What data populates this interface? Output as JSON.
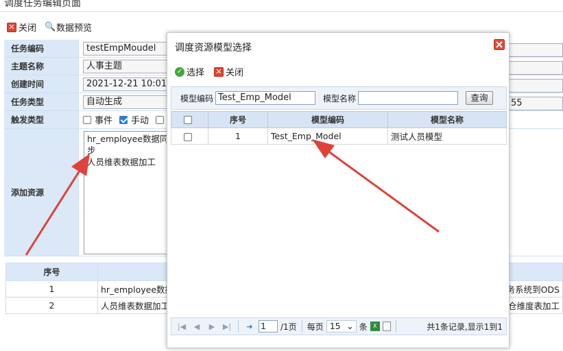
{
  "page_title": "调度任务编辑页面",
  "toolbar": {
    "close_label": "关闭",
    "preview_label": "数据预览"
  },
  "form": {
    "task_code": {
      "label": "任务编码",
      "value": "testEmpMoudel"
    },
    "subject": {
      "label": "主题名称",
      "value": "人事主题"
    },
    "created": {
      "label": "创建时间",
      "value": "2021-12-21 10:01"
    },
    "task_type": {
      "label": "任务类型",
      "value": "自动生成",
      "right_value": "55"
    },
    "trigger": {
      "label": "触发类型",
      "opt_event": "事件",
      "opt_manual": "手动",
      "event_checked": false,
      "manual_checked": true
    },
    "add_resource": {
      "label": "添加资源",
      "line1": "hr_employee数据同步",
      "line2": "人员维表数据加工"
    }
  },
  "bottom_table": {
    "header_seq": "序号",
    "rows": [
      {
        "seq": "1",
        "name": "hr_employee数据",
        "right": "务系统到ODS"
      },
      {
        "seq": "2",
        "name": "人员维表数据加工",
        "right": "仓维度表加工"
      }
    ]
  },
  "modal": {
    "title": "调度资源模型选择",
    "select_label": "选择",
    "close_label": "关闭",
    "search": {
      "code_label": "模型编码",
      "code_value": "Test_Emp_Model",
      "name_label": "模型名称",
      "name_value": "",
      "query_label": "查询"
    },
    "columns": {
      "seq": "序号",
      "code": "模型编码",
      "name": "模型名称"
    },
    "rows": [
      {
        "seq": "1",
        "code": "Test_Emp_Model",
        "name": "测试人员模型"
      }
    ],
    "pager": {
      "page": "1",
      "of_pages": "/1页",
      "per_page_label": "每页",
      "per_page": "15",
      "unit": "条",
      "info": "共1条记录,显示1到1"
    }
  },
  "colors": {
    "label_bg": "#dbe8f7",
    "header_bg": "#d7e4f3",
    "arrow": "#e0413a"
  }
}
